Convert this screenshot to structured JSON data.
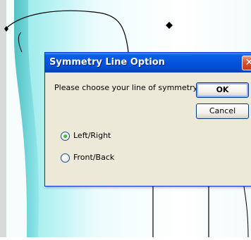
{
  "dialog": {
    "title": "Symmetry Line Option",
    "close_symbol": "✕",
    "prompt": "Please choose your line of symmetry.",
    "ok_label": "OK",
    "cancel_label": "Cancel",
    "options": [
      {
        "label": "Left/Right",
        "selected": true
      },
      {
        "label": "Front/Back",
        "selected": false
      }
    ]
  },
  "colors": {
    "titlebar": "#0453dd",
    "dialog_face": "#ece9d8",
    "background_gradient_start": "#7fe3e6",
    "close_button": "#d9542e",
    "radio_selected": "#21a121"
  },
  "icons": [
    "close-icon",
    "diamond-marker-icon"
  ]
}
